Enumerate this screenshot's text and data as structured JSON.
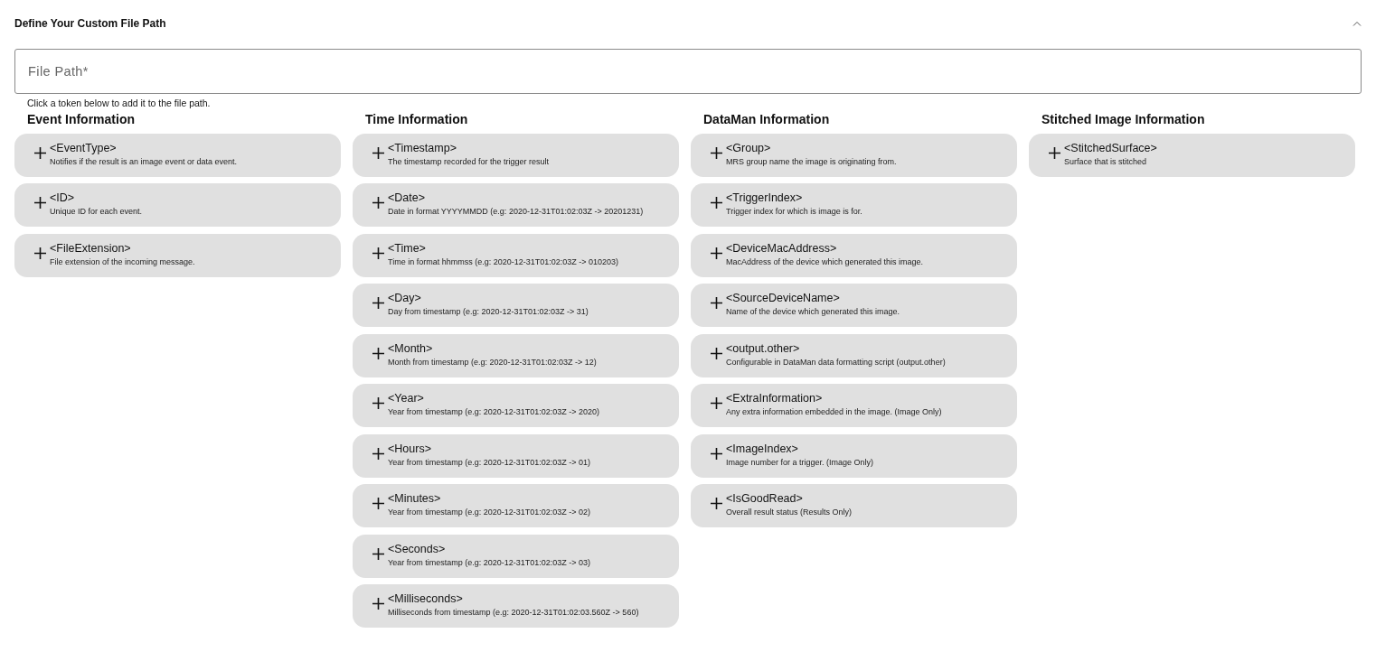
{
  "panel": {
    "title": "Define Your Custom File Path",
    "expanded": true
  },
  "file_path": {
    "placeholder": "File Path*"
  },
  "hint": "Click a token below to add it to the file path.",
  "groups": [
    {
      "heading": "Event Information",
      "tokens": [
        {
          "name": "<EventType>",
          "description": "Notifies if the result is an image event or data event."
        },
        {
          "name": "<ID>",
          "description": "Unique ID for each event."
        },
        {
          "name": "<FileExtension>",
          "description": "File extension of the incoming message."
        }
      ]
    },
    {
      "heading": "Time Information",
      "tokens": [
        {
          "name": "<Timestamp>",
          "description": "The timestamp recorded for the trigger result"
        },
        {
          "name": "<Date>",
          "description": "Date in format YYYYMMDD (e.g: 2020-12-31T01:02:03Z -> 20201231)"
        },
        {
          "name": "<Time>",
          "description": "Time in format hhmmss (e.g: 2020-12-31T01:02:03Z -> 010203)"
        },
        {
          "name": "<Day>",
          "description": "Day from timestamp (e.g: 2020-12-31T01:02:03Z -> 31)"
        },
        {
          "name": "<Month>",
          "description": "Month from timestamp (e.g: 2020-12-31T01:02:03Z -> 12)"
        },
        {
          "name": "<Year>",
          "description": "Year from timestamp (e.g: 2020-12-31T01:02:03Z -> 2020)"
        },
        {
          "name": "<Hours>",
          "description": "Year from timestamp (e.g: 2020-12-31T01:02:03Z -> 01)"
        },
        {
          "name": "<Minutes>",
          "description": "Year from timestamp (e.g: 2020-12-31T01:02:03Z -> 02)"
        },
        {
          "name": "<Seconds>",
          "description": "Year from timestamp (e.g: 2020-12-31T01:02:03Z -> 03)"
        },
        {
          "name": "<Milliseconds>",
          "description": "Milliseconds from timestamp (e.g: 2020-12-31T01:02:03.560Z -> 560)"
        }
      ]
    },
    {
      "heading": "DataMan Information",
      "tokens": [
        {
          "name": "<Group>",
          "description": "MRS group name the image is originating from."
        },
        {
          "name": "<TriggerIndex>",
          "description": "Trigger index for which is image is for."
        },
        {
          "name": "<DeviceMacAddress>",
          "description": "MacAddress of the device which generated this image."
        },
        {
          "name": "<SourceDeviceName>",
          "description": "Name of the device which generated this image."
        },
        {
          "name": "<output.other>",
          "description": "Configurable in DataMan data formatting script (output.other)"
        },
        {
          "name": "<ExtraInformation>",
          "description": "Any extra information embedded in the image. (Image Only)"
        },
        {
          "name": "<ImageIndex>",
          "description": "Image number for a trigger. (Image Only)"
        },
        {
          "name": "<IsGoodRead>",
          "description": "Overall result status (Results Only)"
        }
      ]
    },
    {
      "heading": "Stitched Image Information",
      "tokens": [
        {
          "name": "<StitchedSurface>",
          "description": "Surface that is stitched"
        }
      ]
    }
  ]
}
